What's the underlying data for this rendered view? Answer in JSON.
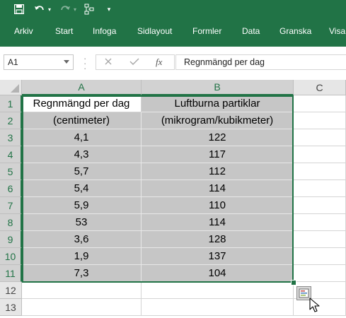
{
  "ribbon": {
    "tabs": [
      "Arkiv",
      "Start",
      "Infoga",
      "Sidlayout",
      "Formler",
      "Data",
      "Granska",
      "Visa"
    ]
  },
  "quick_access": {
    "icons": [
      "save-icon",
      "undo-icon",
      "redo-icon",
      "touch-mode-icon",
      "customize-qat-icon"
    ]
  },
  "formula_bar": {
    "name_box": "A1",
    "fx_label": "fx",
    "formula": "Regnmängd per dag"
  },
  "grid": {
    "columns": [
      "A",
      "B",
      "C"
    ],
    "rows": [
      "1",
      "2",
      "3",
      "4",
      "5",
      "6",
      "7",
      "8",
      "9",
      "10",
      "11",
      "12",
      "13"
    ],
    "cells": [
      [
        "Regnmängd per dag",
        "Luftburna partiklar"
      ],
      [
        "(centimeter)",
        "(mikrogram/kubikmeter)"
      ],
      [
        "4,1",
        "122"
      ],
      [
        "4,3",
        "117"
      ],
      [
        "5,7",
        "112"
      ],
      [
        "5,4",
        "114"
      ],
      [
        "5,9",
        "110"
      ],
      [
        "53",
        "114"
      ],
      [
        "3,6",
        "128"
      ],
      [
        "1,9",
        "137"
      ],
      [
        "7,3",
        "104"
      ]
    ],
    "selected_range": "A1:B11"
  },
  "colors": {
    "accent": "#217346",
    "selection_fill": "#c6c6c6"
  }
}
